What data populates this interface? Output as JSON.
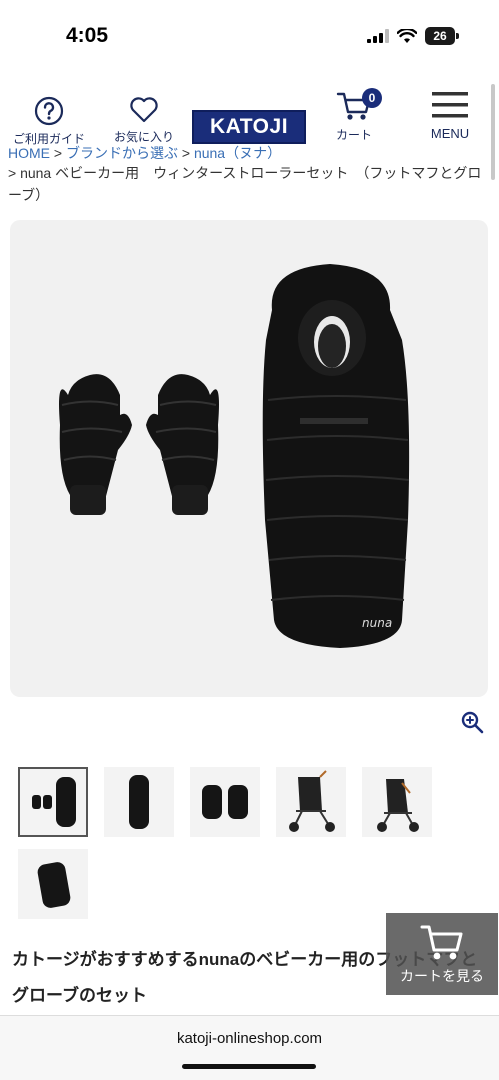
{
  "status_bar": {
    "time": "4:05",
    "battery": "26"
  },
  "header": {
    "guide_label": "ご利用ガイド",
    "favorites_label": "お気に入り",
    "logo_text": "KATOJI",
    "cart_label": "カート",
    "cart_count": "0",
    "menu_label": "MENU"
  },
  "breadcrumb": {
    "home": "HOME",
    "sep": " > ",
    "brand_select": "ブランドから選ぶ",
    "brand": "nuna（ヌナ）",
    "current": "> nuna ベビーカー用　ウィンターストローラーセット　（フットマフとグローブ）"
  },
  "floating_cart": {
    "label": "カートを見る"
  },
  "description": {
    "line1": "カトージがおすすめするnunaのベビーカー用のフットマフと",
    "line2": "グローブのセット"
  },
  "browser": {
    "url": "katoji-onlineshop.com"
  },
  "product_logo": "nuna",
  "colors": {
    "brand_navy": "#1a2d7a",
    "link_blue": "#3a6fb5"
  }
}
